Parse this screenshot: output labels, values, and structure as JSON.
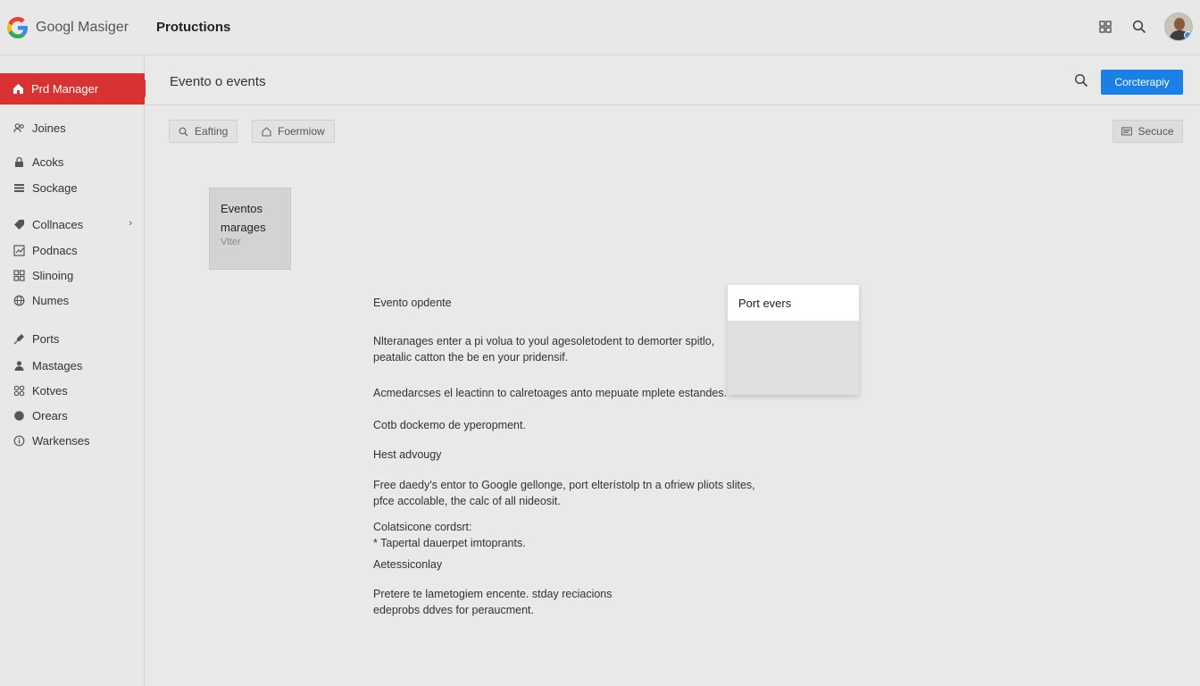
{
  "app": {
    "brand": "Googl Masiger",
    "page_title": "Protuctions"
  },
  "sidebar": {
    "active": {
      "label": "Prd Manager"
    },
    "items": [
      {
        "label": "Joines",
        "icon": "people-icon"
      },
      {
        "label": "Acoks",
        "icon": "lock-icon"
      },
      {
        "label": "Sockage",
        "icon": "list-icon"
      },
      {
        "label": "Collnaces",
        "icon": "tag-icon",
        "has_chevron": true
      },
      {
        "label": "Podnacs",
        "icon": "chart-icon"
      },
      {
        "label": "Slinoing",
        "icon": "grid-icon"
      },
      {
        "label": "Numes",
        "icon": "globe-icon"
      },
      {
        "label": "Ports",
        "icon": "pin-icon"
      },
      {
        "label": "Mastages",
        "icon": "person-icon"
      },
      {
        "label": "Kotves",
        "icon": "apps-icon"
      },
      {
        "label": "Orears",
        "icon": "circle-icon"
      },
      {
        "label": "Warkenses",
        "icon": "info-icon"
      }
    ]
  },
  "main": {
    "section_title": "Evento o events",
    "primary_button": "Corcterapiy",
    "chips": [
      {
        "label": "Eafting"
      },
      {
        "label": "Foermiow"
      }
    ],
    "secondary_button": "Secuce",
    "card": {
      "title": "Eventos marages",
      "subtitle": "Vlter"
    },
    "content": [
      "Evento opdente",
      "Nlteranages enter a pi volua to youl agesoletodent to demorter spitlo,",
      "peatalic catton the be en your pridensif.",
      "Acmedarcses el leactinn to calretoages anto mepuate mplete estandes.",
      "Cotb dockemo de yperopment.",
      "Hest advougy",
      "Free daedy's entor to Google gellonge, port elterístolp tn a ofriew pliots slites,",
      "pfce accolable, the calc of all nideosit.",
      "Colatsicone cordsrt:",
      "* Tapertal dauerpet imtoprants.",
      "Aetessiconlay",
      "Pretere te lametogiem encente. stday reciacions",
      "edeprobs ddves for peraucment."
    ],
    "popup": {
      "item": "Port evers"
    }
  },
  "colors": {
    "accent": "#d93232",
    "primary": "#1a80e5"
  }
}
